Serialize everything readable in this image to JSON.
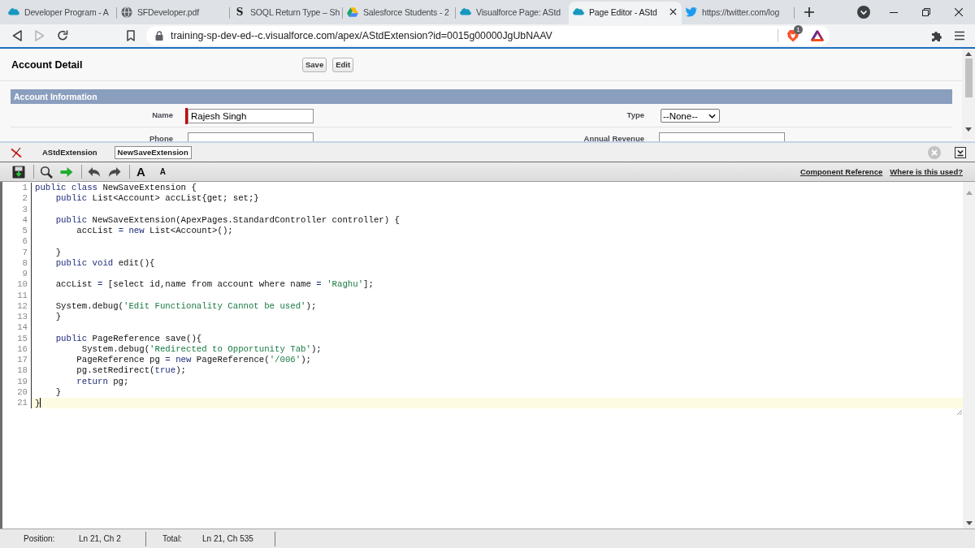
{
  "browser": {
    "tabs": [
      {
        "title": "Developer Program - A",
        "kind": "cloud",
        "selected": false
      },
      {
        "title": "SFDeveloper.pdf",
        "kind": "globe",
        "selected": false
      },
      {
        "title": "SOQL Return Type – Sh",
        "kind": "letter",
        "favicon_text": "S",
        "selected": false
      },
      {
        "title": "Salesforce Students - 2",
        "kind": "drive",
        "selected": false
      },
      {
        "title": "Visualforce Page: AStd",
        "kind": "cloud",
        "selected": false
      },
      {
        "title": "Page Editor - AStd",
        "kind": "cloud",
        "selected": true
      },
      {
        "title": "https://twitter.com/log",
        "kind": "bird",
        "selected": false
      }
    ],
    "forward_disabled": true,
    "url": "training-sp-dev-ed--c.visualforce.com/apex/AStdExtension?id=0015g00000JgUbNAAV",
    "shield_count": "1"
  },
  "page": {
    "title": "Account Detail",
    "buttons": [
      "Save",
      "Edit"
    ],
    "section": "Account Information",
    "fields": [
      {
        "label": "Name",
        "kind": "text",
        "value": "Rajesh Singh",
        "required": true
      },
      {
        "label": "Type",
        "kind": "select",
        "value": "--None--",
        "required": false
      },
      {
        "label": "Phone",
        "kind": "text",
        "required": false
      },
      {
        "label": "Annual Revenue",
        "kind": "text",
        "required": false
      }
    ]
  },
  "editor": {
    "tabs": [
      {
        "label": "AStdExtension",
        "selected": false
      },
      {
        "label": "NewSaveExtension",
        "selected": true
      }
    ],
    "font_buttons": [
      {
        "label": "A",
        "kind": "larger"
      },
      {
        "label": "A",
        "kind": "smaller"
      }
    ],
    "links": [
      "Component Reference",
      "Where is this used?"
    ],
    "lines": [
      {
        "number": "1",
        "current": false,
        "tokens": [
          {
            "kind": "keyword",
            "text": "public class"
          },
          {
            "kind": "plain",
            "text": " NewSaveExtension {"
          }
        ]
      },
      {
        "number": "2",
        "current": false,
        "tokens": [
          {
            "kind": "keyword",
            "text": "    public"
          },
          {
            "kind": "plain",
            "text": " List<Account> accList{get; set;}"
          }
        ]
      },
      {
        "number": "3",
        "current": false
      },
      {
        "number": "4",
        "current": false,
        "tokens": [
          {
            "kind": "keyword",
            "text": "    public"
          },
          {
            "kind": "plain",
            "text": " NewSaveExtension(ApexPages.StandardController controller) {"
          }
        ]
      },
      {
        "number": "5",
        "current": false,
        "tokens": [
          {
            "kind": "plain",
            "text": "        accList "
          },
          {
            "kind": "operator",
            "text": "="
          },
          {
            "kind": "keyword",
            "text": " new"
          },
          {
            "kind": "plain",
            "text": " List<Account>();"
          }
        ]
      },
      {
        "number": "6",
        "current": false
      },
      {
        "number": "7",
        "current": false,
        "tokens": [
          {
            "kind": "plain",
            "text": "    }"
          }
        ]
      },
      {
        "number": "8",
        "current": false,
        "tokens": [
          {
            "kind": "keyword",
            "text": "    public void"
          },
          {
            "kind": "plain",
            "text": " edit(){"
          }
        ]
      },
      {
        "number": "9",
        "current": false
      },
      {
        "number": "10",
        "current": false,
        "tokens": [
          {
            "kind": "plain",
            "text": "    accList "
          },
          {
            "kind": "operator",
            "text": "="
          },
          {
            "kind": "plain",
            "text": " [select id,name from account where name "
          },
          {
            "kind": "operator",
            "text": "="
          },
          {
            "kind": "string",
            "text": " 'Raghu'"
          },
          {
            "kind": "plain",
            "text": "];"
          }
        ]
      },
      {
        "number": "11",
        "current": false
      },
      {
        "number": "12",
        "current": false,
        "tokens": [
          {
            "kind": "plain",
            "text": "    System.debug("
          },
          {
            "kind": "string",
            "text": "'Edit Functionality Cannot be used'"
          },
          {
            "kind": "plain",
            "text": ");"
          }
        ]
      },
      {
        "number": "13",
        "current": false,
        "tokens": [
          {
            "kind": "plain",
            "text": "    }"
          }
        ]
      },
      {
        "number": "14",
        "current": false
      },
      {
        "number": "15",
        "current": false,
        "tokens": [
          {
            "kind": "keyword",
            "text": "    public"
          },
          {
            "kind": "plain",
            "text": " PageReference save(){"
          }
        ]
      },
      {
        "number": "16",
        "current": false,
        "tokens": [
          {
            "kind": "plain",
            "text": "         System.debug("
          },
          {
            "kind": "string",
            "text": "'Redirected to Opportunity Tab'"
          },
          {
            "kind": "plain",
            "text": ");"
          }
        ]
      },
      {
        "number": "17",
        "current": false,
        "tokens": [
          {
            "kind": "plain",
            "text": "        PageReference pg "
          },
          {
            "kind": "operator",
            "text": "="
          },
          {
            "kind": "keyword",
            "text": " new"
          },
          {
            "kind": "plain",
            "text": " PageReference("
          },
          {
            "kind": "string",
            "text": "'/006'"
          },
          {
            "kind": "plain",
            "text": ");"
          }
        ]
      },
      {
        "number": "18",
        "current": false,
        "tokens": [
          {
            "kind": "plain",
            "text": "        pg.setRedirect("
          },
          {
            "kind": "keyword",
            "text": "true"
          },
          {
            "kind": "plain",
            "text": ");"
          }
        ]
      },
      {
        "number": "19",
        "current": false,
        "tokens": [
          {
            "kind": "keyword",
            "text": "        return"
          },
          {
            "kind": "plain",
            "text": " pg;"
          }
        ]
      },
      {
        "number": "20",
        "current": false,
        "tokens": [
          {
            "kind": "plain",
            "text": "    }"
          }
        ]
      },
      {
        "number": "21",
        "current": true,
        "tokens": [
          {
            "kind": "plain",
            "text": "}"
          }
        ]
      }
    ],
    "status": {
      "position_label": "Position:",
      "position": "Ln 21, Ch 2",
      "total_label": "Total:",
      "total": "Ln 21, Ch 535"
    }
  }
}
